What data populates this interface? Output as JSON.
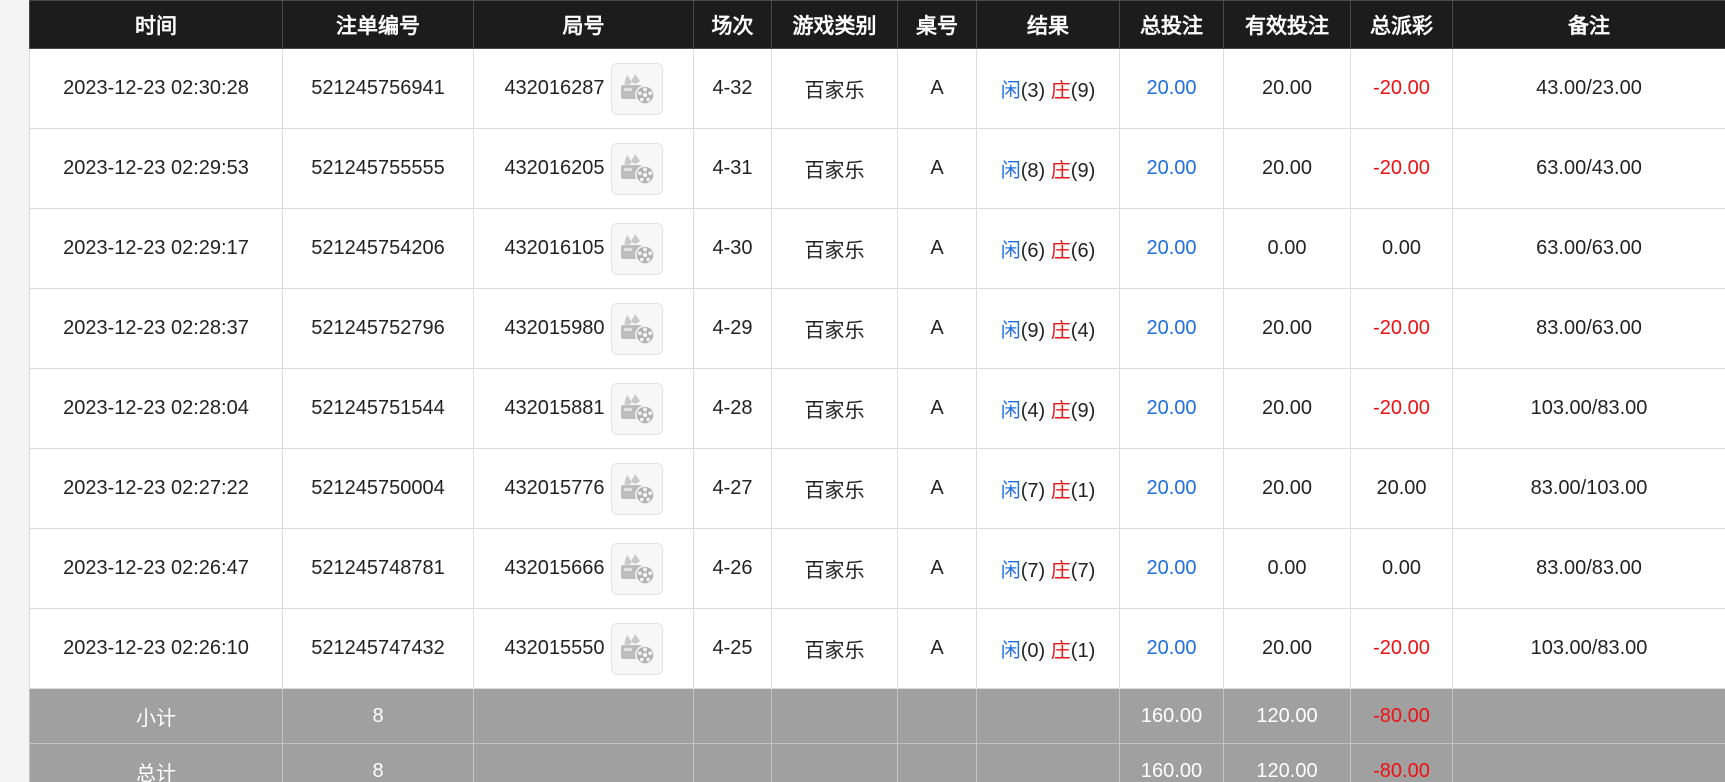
{
  "columns": [
    "时间",
    "注单编号",
    "局号",
    "场次",
    "游戏类别",
    "桌号",
    "结果",
    "总投注",
    "有效投注",
    "总派彩",
    "备注"
  ],
  "rows": [
    {
      "time": "2023-12-23 02:30:28",
      "order": "521245756941",
      "round": "432016287",
      "session": "4-32",
      "game": "百家乐",
      "table": "A",
      "player_label": "闲",
      "player_pts": "(3)",
      "banker_label": "庄",
      "banker_pts": "(9)",
      "bet": "20.00",
      "valid": "20.00",
      "payout": "-20.00",
      "note": "43.00/23.00"
    },
    {
      "time": "2023-12-23 02:29:53",
      "order": "521245755555",
      "round": "432016205",
      "session": "4-31",
      "game": "百家乐",
      "table": "A",
      "player_label": "闲",
      "player_pts": "(8)",
      "banker_label": "庄",
      "banker_pts": "(9)",
      "bet": "20.00",
      "valid": "20.00",
      "payout": "-20.00",
      "note": "63.00/43.00"
    },
    {
      "time": "2023-12-23 02:29:17",
      "order": "521245754206",
      "round": "432016105",
      "session": "4-30",
      "game": "百家乐",
      "table": "A",
      "player_label": "闲",
      "player_pts": "(6)",
      "banker_label": "庄",
      "banker_pts": "(6)",
      "bet": "20.00",
      "valid": "0.00",
      "payout": "0.00",
      "note": "63.00/63.00"
    },
    {
      "time": "2023-12-23 02:28:37",
      "order": "521245752796",
      "round": "432015980",
      "session": "4-29",
      "game": "百家乐",
      "table": "A",
      "player_label": "闲",
      "player_pts": "(9)",
      "banker_label": "庄",
      "banker_pts": "(4)",
      "bet": "20.00",
      "valid": "20.00",
      "payout": "-20.00",
      "note": "83.00/63.00"
    },
    {
      "time": "2023-12-23 02:28:04",
      "order": "521245751544",
      "round": "432015881",
      "session": "4-28",
      "game": "百家乐",
      "table": "A",
      "player_label": "闲",
      "player_pts": "(4)",
      "banker_label": "庄",
      "banker_pts": "(9)",
      "bet": "20.00",
      "valid": "20.00",
      "payout": "-20.00",
      "note": "103.00/83.00"
    },
    {
      "time": "2023-12-23 02:27:22",
      "order": "521245750004",
      "round": "432015776",
      "session": "4-27",
      "game": "百家乐",
      "table": "A",
      "player_label": "闲",
      "player_pts": "(7)",
      "banker_label": "庄",
      "banker_pts": "(1)",
      "bet": "20.00",
      "valid": "20.00",
      "payout": "20.00",
      "note": "83.00/103.00"
    },
    {
      "time": "2023-12-23 02:26:47",
      "order": "521245748781",
      "round": "432015666",
      "session": "4-26",
      "game": "百家乐",
      "table": "A",
      "player_label": "闲",
      "player_pts": "(7)",
      "banker_label": "庄",
      "banker_pts": "(7)",
      "bet": "20.00",
      "valid": "0.00",
      "payout": "0.00",
      "note": "83.00/83.00"
    },
    {
      "time": "2023-12-23 02:26:10",
      "order": "521245747432",
      "round": "432015550",
      "session": "4-25",
      "game": "百家乐",
      "table": "A",
      "player_label": "闲",
      "player_pts": "(0)",
      "banker_label": "庄",
      "banker_pts": "(1)",
      "bet": "20.00",
      "valid": "20.00",
      "payout": "-20.00",
      "note": "103.00/83.00"
    }
  ],
  "subtotal": {
    "label": "小计",
    "count": "8",
    "bet": "160.00",
    "valid": "120.00",
    "payout": "-80.00"
  },
  "total": {
    "label": "总计",
    "count": "8",
    "bet": "160.00",
    "valid": "120.00",
    "payout": "-80.00"
  },
  "colors": {
    "header_bg": "#1c1c1c",
    "footer_bg": "#a0a0a0",
    "blue": "#1f6fe0",
    "red": "#ee1111"
  },
  "icons": {
    "replay": "video-replay-icon"
  }
}
